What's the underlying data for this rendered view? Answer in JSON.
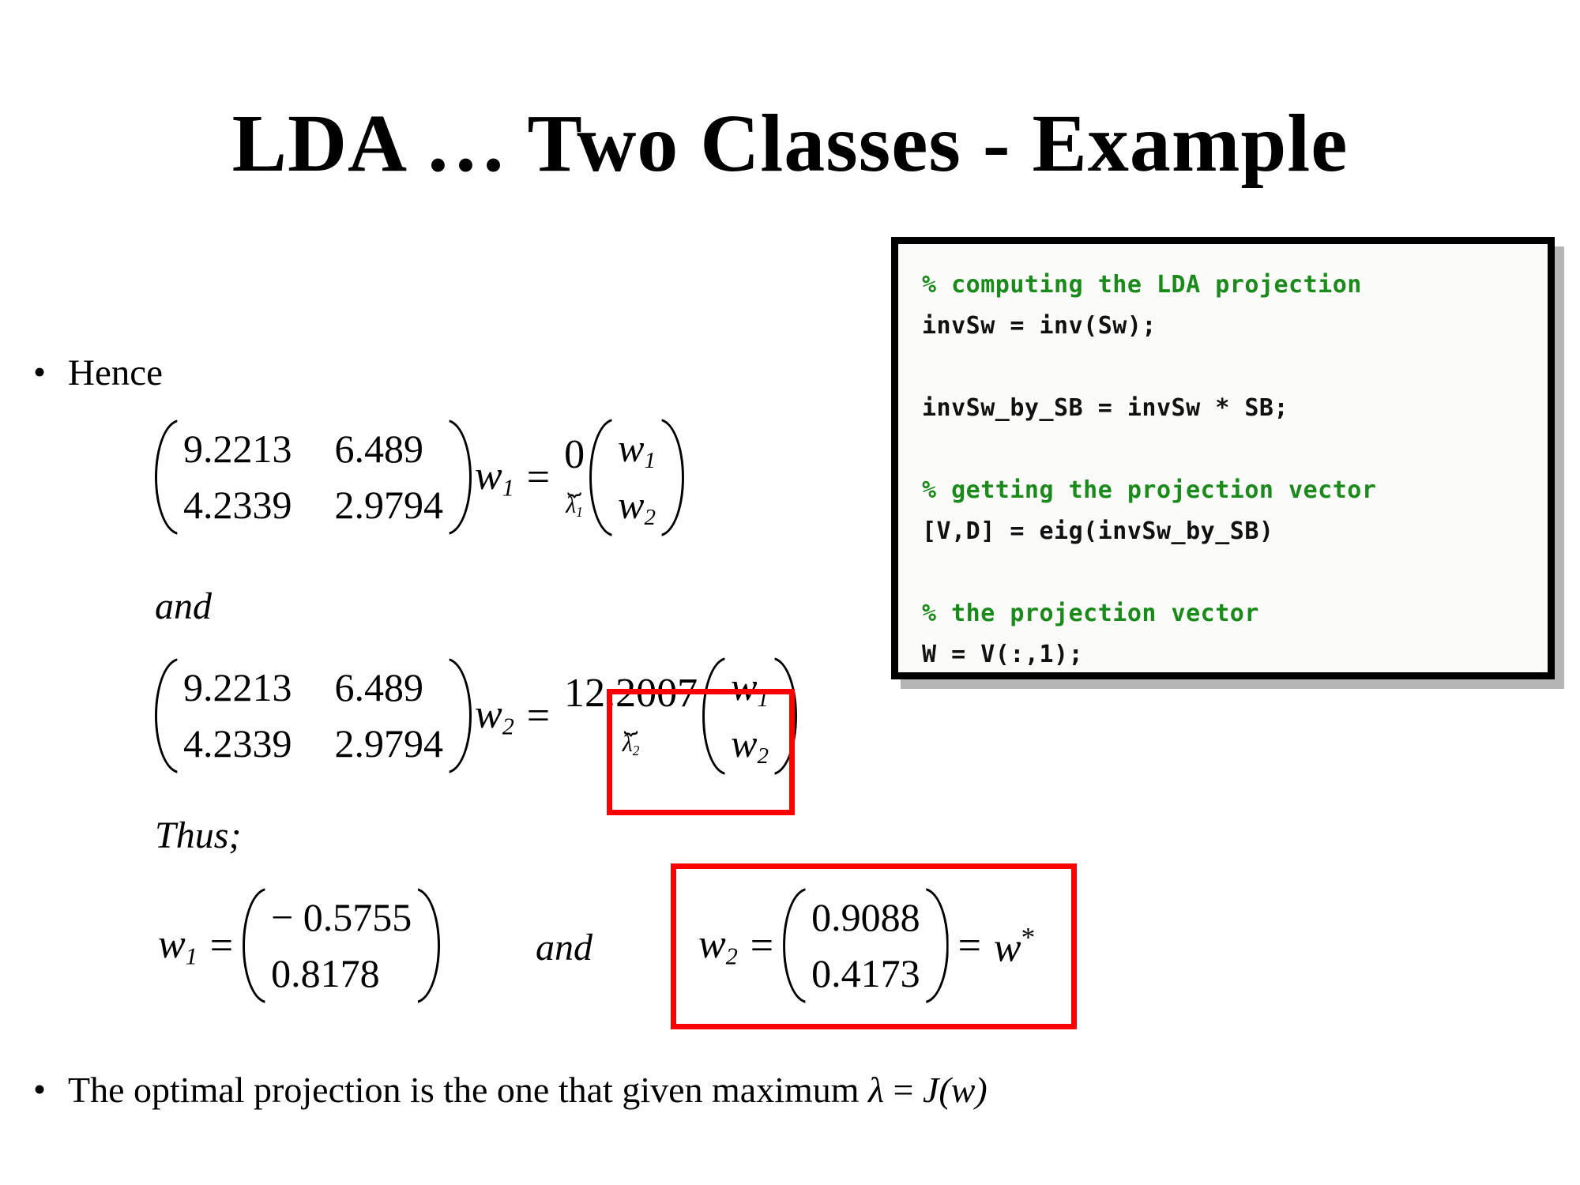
{
  "slide": {
    "title": "LDA … Two Classes - Example"
  },
  "code_panel": {
    "name": "matlab-code-box",
    "comment_color": "#1a8a1a",
    "lines": [
      {
        "type": "comment",
        "text": "% computing the LDA projection"
      },
      {
        "type": "code",
        "text": "invSw = inv(Sw);"
      },
      {
        "type": "blank",
        "text": ""
      },
      {
        "type": "code",
        "text": "invSw_by_SB = invSw * SB;"
      },
      {
        "type": "blank",
        "text": ""
      },
      {
        "type": "comment",
        "text": "% getting the projection vector"
      },
      {
        "type": "code",
        "text": "[V,D] = eig(invSw_by_SB)"
      },
      {
        "type": "blank",
        "text": ""
      },
      {
        "type": "comment",
        "text": "% the projection vector"
      },
      {
        "type": "code",
        "text": "W = V(:,1);"
      }
    ]
  },
  "bullets": {
    "marker": "•",
    "hence": "Hence",
    "optimal_prefix": "The optimal projection is the one that given maximum ",
    "optimal_lambda": "λ",
    "optimal_eq": " = ",
    "optimal_jw": "J(w)"
  },
  "labels": {
    "and": "and",
    "thus": "Thus;",
    "and2": "and"
  },
  "equations": {
    "eq1": {
      "matrix": [
        [
          "9.2213",
          "6.489"
        ],
        [
          "4.2339",
          "2.9794"
        ]
      ],
      "var": "w",
      "var_sub": "1",
      "equals": "=",
      "scalar": "0",
      "brace": "⏟",
      "scalar_label": "λ",
      "scalar_label_sub": "1",
      "vector": [
        [
          "w",
          "1"
        ],
        [
          "w",
          "2"
        ]
      ]
    },
    "eq2": {
      "matrix": [
        [
          "9.2213",
          "6.489"
        ],
        [
          "4.2339",
          "2.9794"
        ]
      ],
      "var": "w",
      "var_sub": "2",
      "equals": "=",
      "scalar": "12.2007",
      "brace": "⏟",
      "scalar_label": "λ",
      "scalar_label_sub": "2",
      "vector": [
        [
          "w",
          "1"
        ],
        [
          "w",
          "2"
        ]
      ],
      "highlight_color": "#ff0000"
    },
    "eq3": {
      "var": "w",
      "var_sub": "1",
      "equals": "=",
      "vector": [
        "− 0.5755",
        "0.8178"
      ]
    },
    "eq4": {
      "var": "w",
      "var_sub": "2",
      "equals": "=",
      "vector": [
        "0.9088",
        "0.4173"
      ],
      "equals2": "=",
      "result_var": "w",
      "result_sup": "*",
      "highlight_color": "#ff0000"
    }
  }
}
